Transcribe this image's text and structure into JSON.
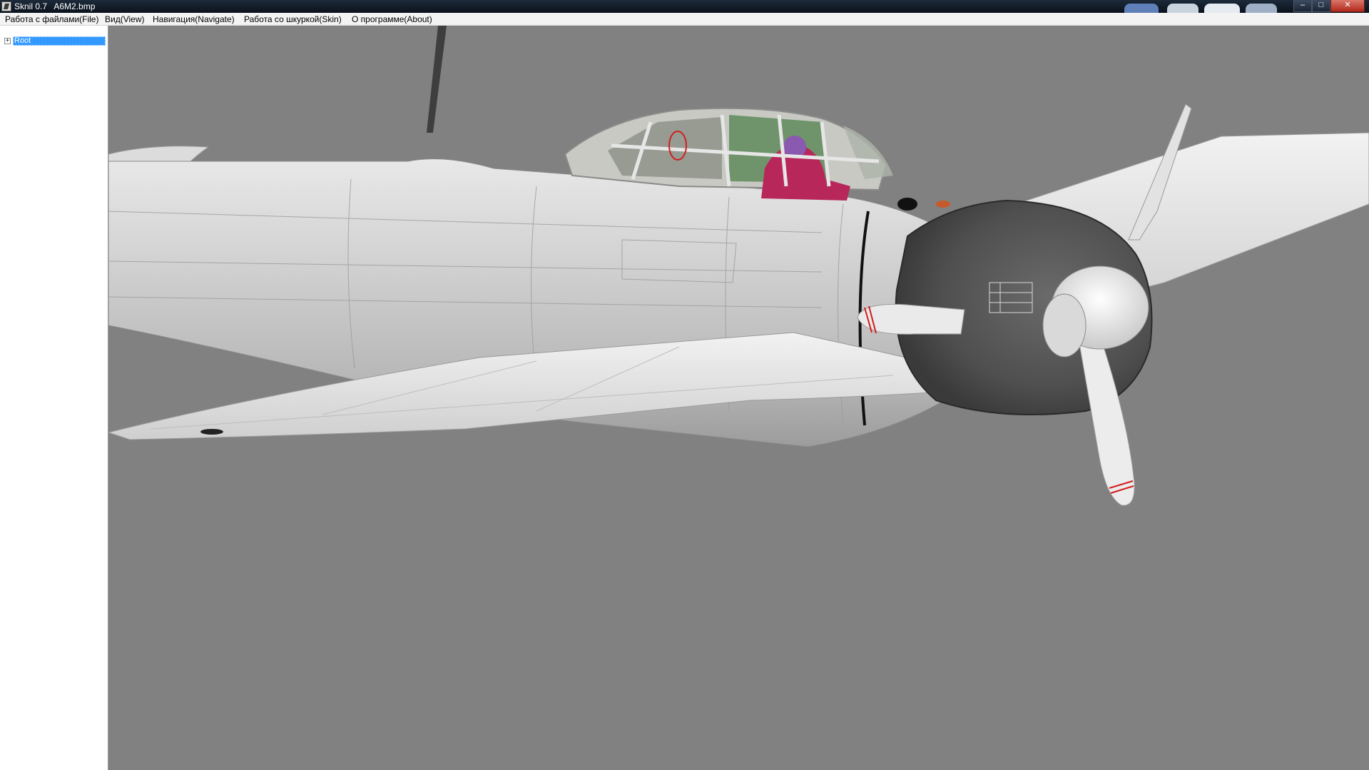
{
  "window": {
    "title": "Sknil 0.7   A6M2.bmp",
    "minimize_glyph": "–",
    "maximize_glyph": "□",
    "close_glyph": "✕"
  },
  "menu": {
    "items": [
      {
        "label": "Работа с файлами(File)"
      },
      {
        "label": "Вид(View)"
      },
      {
        "label": "Навигация(Navigate)"
      },
      {
        "label": "Работа со шкуркой(Skin)"
      },
      {
        "label": "О программе(About)"
      }
    ]
  },
  "tree": {
    "expander_glyph": "+",
    "root_label": "Root"
  },
  "viewport": {
    "background_color": "#818181",
    "model": "aircraft-3d-model"
  }
}
